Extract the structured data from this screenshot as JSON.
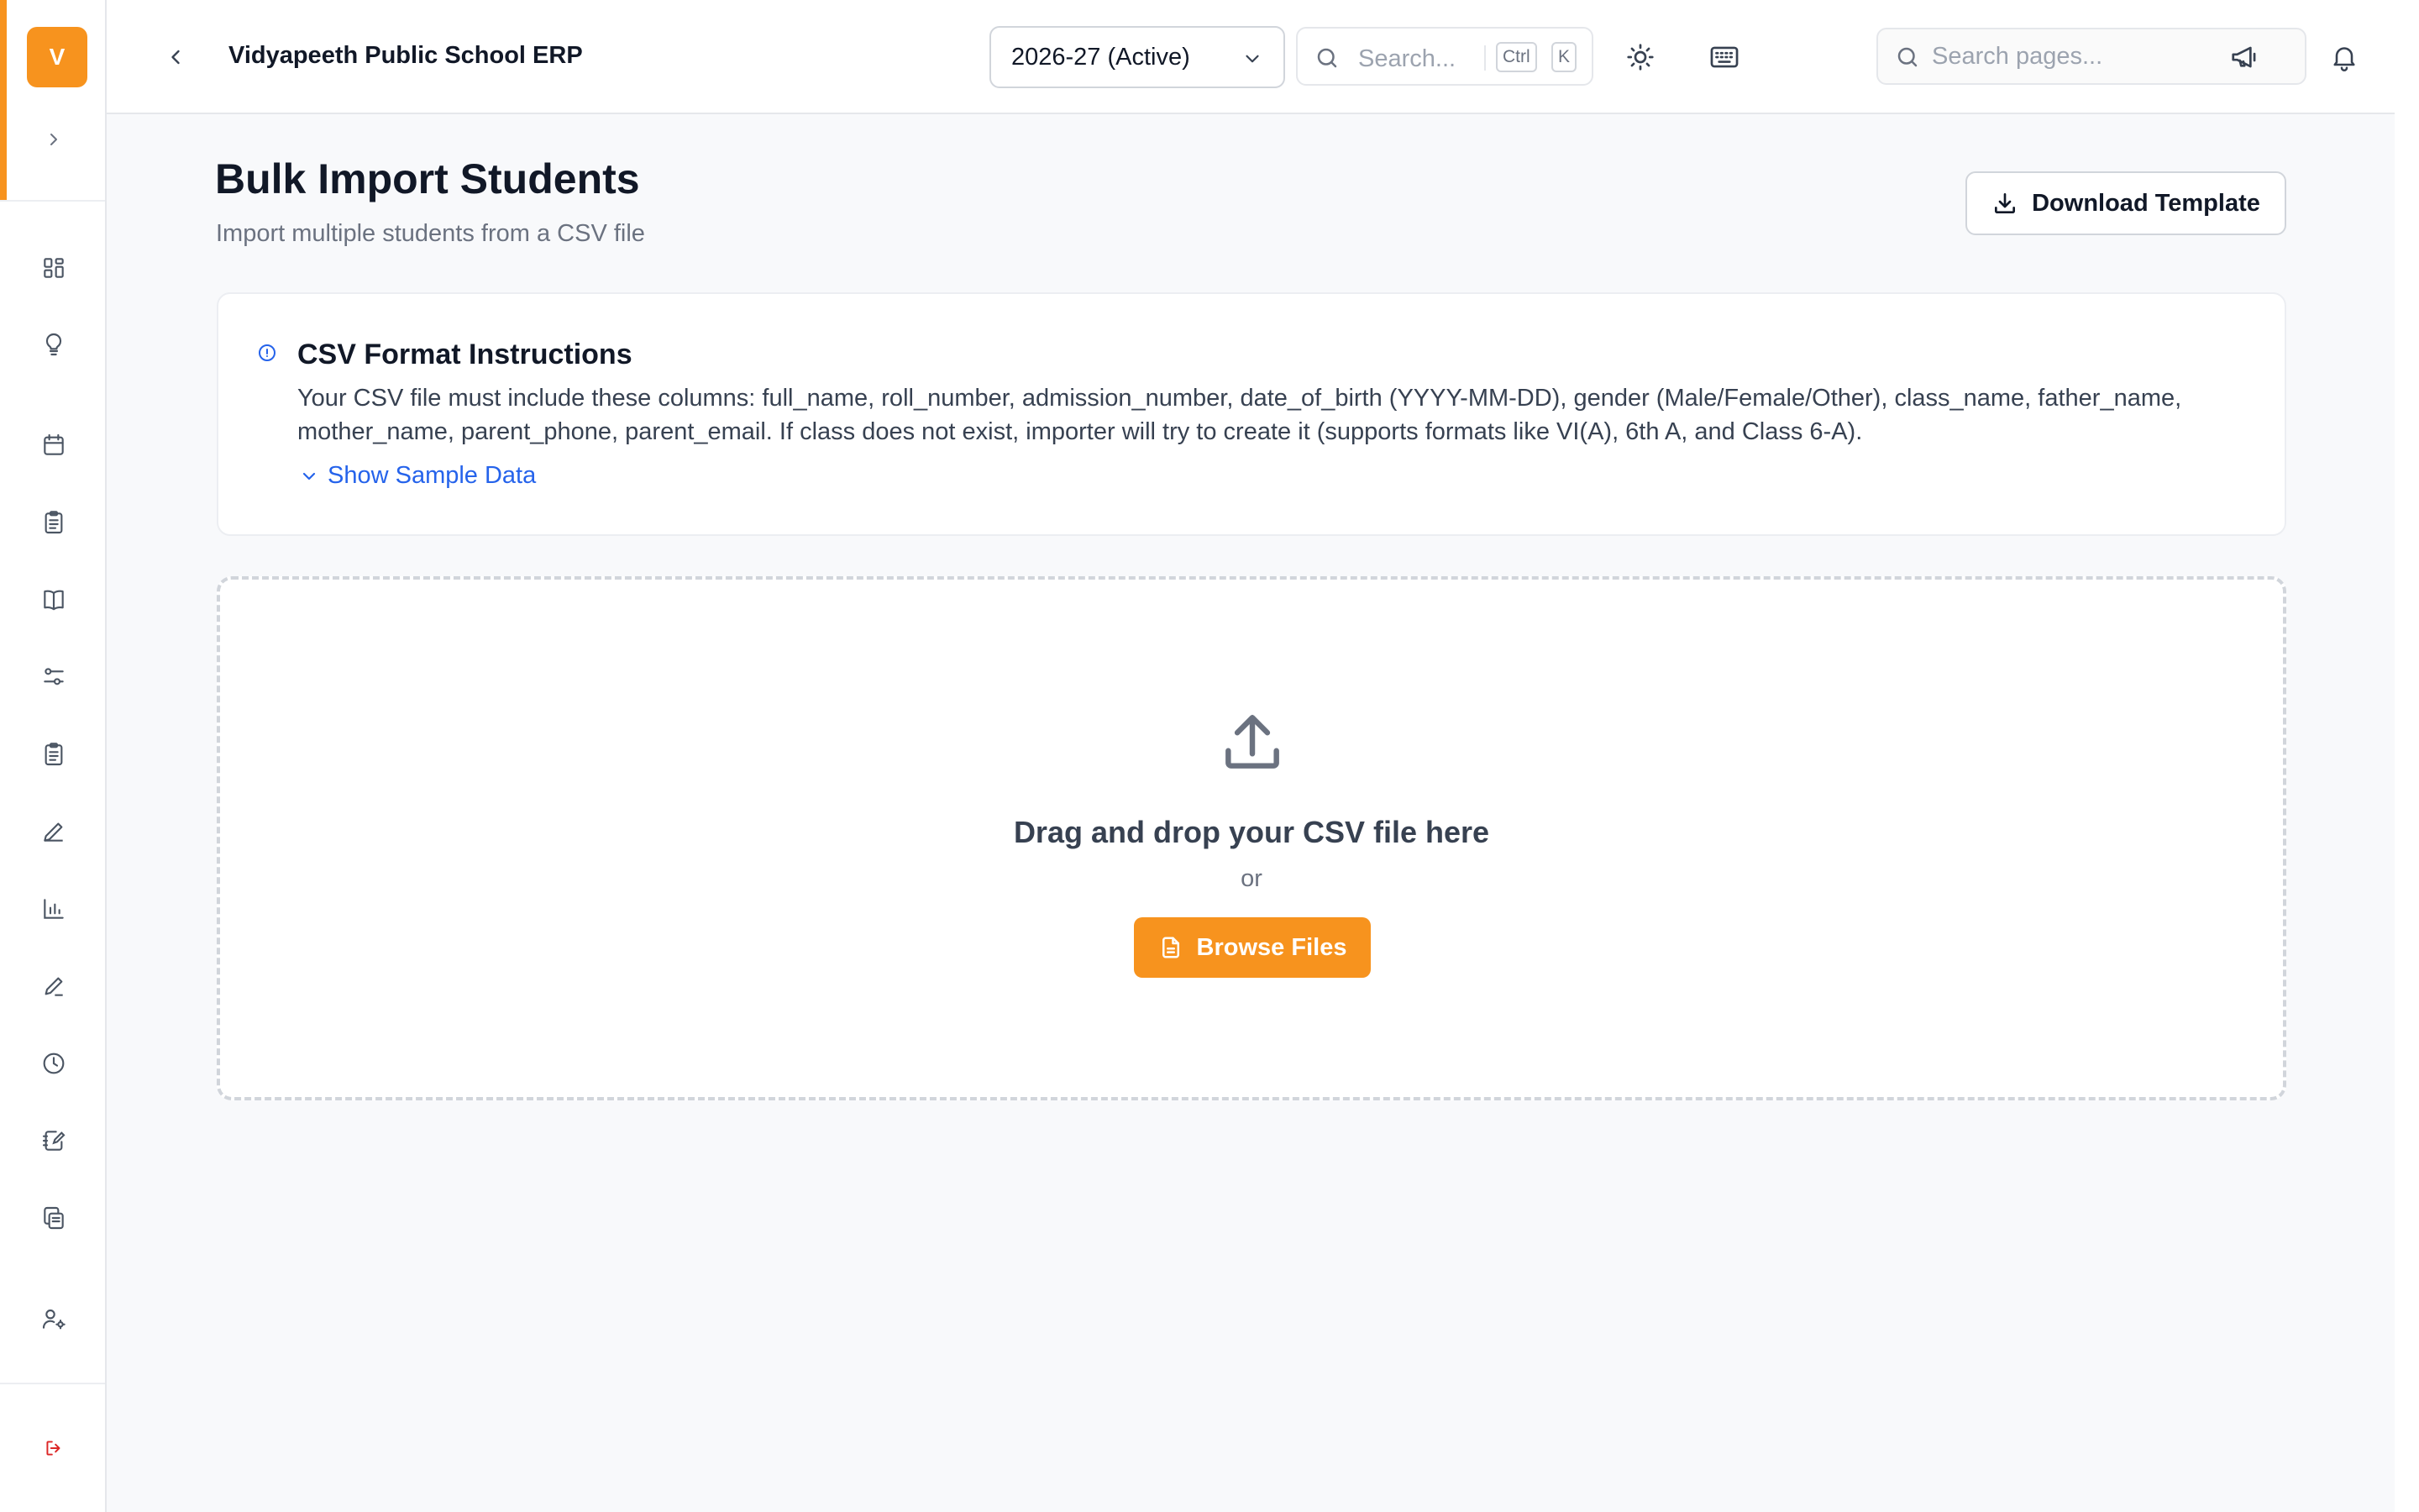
{
  "app": {
    "logo_letter": "V",
    "title": "Vidyapeeth Public School ERP"
  },
  "colors": {
    "accent": "#f7931e",
    "link": "#2563eb",
    "logout": "#dc2626"
  },
  "header": {
    "academic_year": "2026-27 (Active)",
    "quick_search_placeholder": "Search...",
    "shortcut_key_1": "Ctrl",
    "shortcut_key_2": "K",
    "page_search_placeholder": "Search pages..."
  },
  "sidebar": {
    "icons": [
      "dashboard-icon",
      "lightbulb-icon",
      "calendar-icon",
      "clipboard-icon",
      "book-icon",
      "sliders-icon",
      "clipboard-list-icon",
      "pen-icon",
      "bar-chart-icon",
      "edit-icon",
      "clock-icon",
      "notebook-edit-icon",
      "copy-icon",
      "user-settings-icon",
      "logout-icon"
    ]
  },
  "page": {
    "title": "Bulk Import Students",
    "subtitle": "Import multiple students from a CSV file",
    "download_template_label": "Download Template"
  },
  "instructions": {
    "title": "CSV Format Instructions",
    "body": "Your CSV file must include these columns: full_name, roll_number, admission_number, date_of_birth (YYYY-MM-DD), gender (Male/Female/Other), class_name, father_name, mother_name, parent_phone, parent_email. If class does not exist, importer will try to create it (supports formats like VI(A), 6th A, and Class 6-A).",
    "sample_link": "Show Sample Data"
  },
  "dropzone": {
    "title": "Drag and drop your CSV file here",
    "or_text": "or",
    "browse_label": "Browse Files"
  }
}
